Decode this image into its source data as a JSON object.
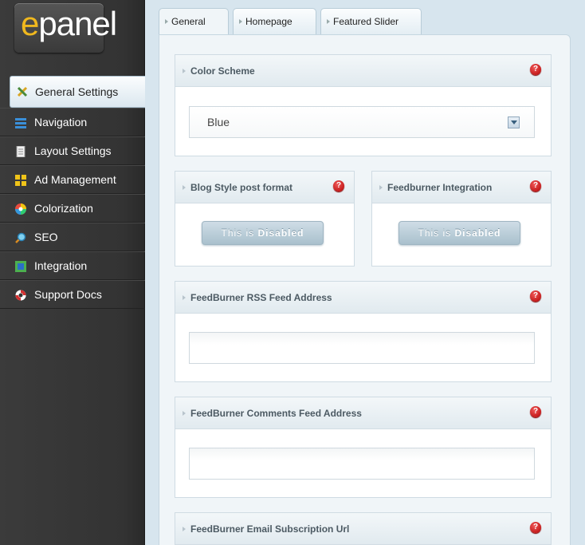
{
  "logo": {
    "first": "e",
    "rest": "panel"
  },
  "nav": [
    {
      "label": "General Settings",
      "icon": "tools-icon"
    },
    {
      "label": "Navigation",
      "icon": "navigation-icon"
    },
    {
      "label": "Layout Settings",
      "icon": "document-icon"
    },
    {
      "label": "Ad Management",
      "icon": "grid-icon"
    },
    {
      "label": "Colorization",
      "icon": "color-wheel-icon"
    },
    {
      "label": "SEO",
      "icon": "magnifier-icon"
    },
    {
      "label": "Integration",
      "icon": "integration-icon"
    },
    {
      "label": "Support Docs",
      "icon": "lifebuoy-icon"
    }
  ],
  "tabs": {
    "general": "General",
    "homepage": "Homepage",
    "featured": "Featured Slider"
  },
  "colorScheme": {
    "title": "Color Scheme",
    "value": "Blue"
  },
  "blogStyle": {
    "title": "Blog Style post format",
    "button_pre": "This is",
    "button_state": "Disabled"
  },
  "feedburnerIntegration": {
    "title": "Feedburner Integration",
    "button_pre": "This is",
    "button_state": "Disabled"
  },
  "rssFeed": {
    "title": "FeedBurner RSS Feed Address",
    "value": ""
  },
  "commentsFeed": {
    "title": "FeedBurner Comments Feed Address",
    "value": ""
  },
  "emailSub": {
    "title": "FeedBurner Email Subscription Url"
  },
  "help": "?",
  "colors": {
    "sidebar": "#333333",
    "accent": "#f0b81e",
    "help": "#cc0000",
    "panel": "#f0f5f8"
  }
}
